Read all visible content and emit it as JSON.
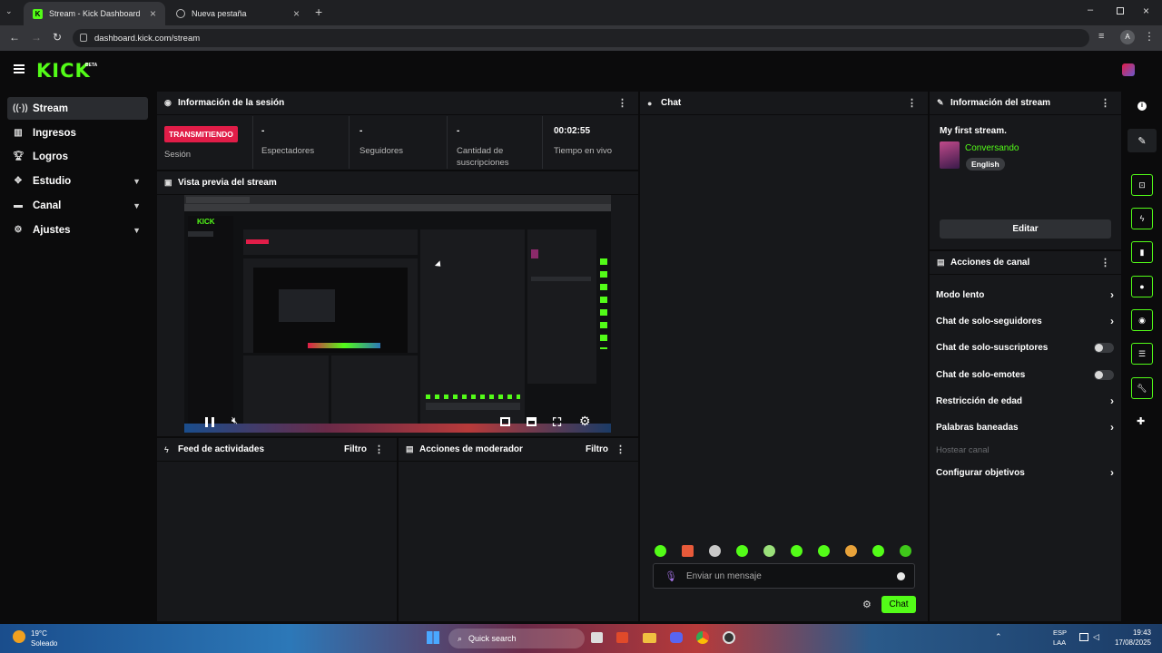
{
  "browser": {
    "tabs": [
      {
        "label": "Stream - Kick Dashboard",
        "active": true
      },
      {
        "label": "Nueva pestaña",
        "active": false
      }
    ],
    "url": "dashboard.kick.com/stream",
    "profile_initial": "A"
  },
  "app": {
    "logo": "KICK",
    "logo_badge": "BETA"
  },
  "sidebar": {
    "items": [
      {
        "label": "Stream",
        "icon": "broadcast-icon",
        "active": true,
        "chevron": false
      },
      {
        "label": "Ingresos",
        "icon": "chart-icon",
        "active": false,
        "chevron": false
      },
      {
        "label": "Logros",
        "icon": "trophy-icon",
        "active": false,
        "chevron": false
      },
      {
        "label": "Estudio",
        "icon": "studio-icon",
        "active": false,
        "chevron": true
      },
      {
        "label": "Canal",
        "icon": "channel-icon",
        "active": false,
        "chevron": true
      },
      {
        "label": "Ajustes",
        "icon": "gear-icon",
        "active": false,
        "chevron": true
      }
    ]
  },
  "session": {
    "title": "Información de la sesión",
    "status_badge": "TRANSMITIENDO",
    "status_label": "Sesión",
    "stats": [
      {
        "value": "-",
        "label": "Espectadores"
      },
      {
        "value": "-",
        "label": "Seguidores"
      },
      {
        "value": "-",
        "label": "Cantidad de suscripciones"
      },
      {
        "value": "00:02:55",
        "label": "Tiempo en vivo"
      }
    ]
  },
  "preview": {
    "title": "Vista previa del stream"
  },
  "activity": {
    "title": "Feed de actividades",
    "filter": "Filtro"
  },
  "modactions": {
    "title": "Acciones de moderador",
    "filter": "Filtro"
  },
  "chat": {
    "title": "Chat",
    "placeholder": "Enviar un mensaje",
    "send_label": "Chat",
    "emote_count": 10
  },
  "streaminfo": {
    "title": "Información del stream",
    "stream_title": "My first stream.",
    "category": "Conversando",
    "language": "English",
    "edit_label": "Editar"
  },
  "channelactions": {
    "title": "Acciones de canal",
    "items": [
      {
        "label": "Modo lento",
        "control": "arrow"
      },
      {
        "label": "Chat de solo-seguidores",
        "control": "arrow"
      },
      {
        "label": "Chat de solo-suscriptores",
        "control": "toggle"
      },
      {
        "label": "Chat de solo-emotes",
        "control": "toggle"
      },
      {
        "label": "Restricción de edad",
        "control": "arrow"
      },
      {
        "label": "Palabras baneadas",
        "control": "arrow"
      },
      {
        "label": "Hostear canal",
        "control": "disabled"
      },
      {
        "label": "Configurar objetivos",
        "control": "arrow"
      }
    ]
  },
  "taskbar": {
    "weather_temp": "19°C",
    "weather_desc": "Soleado",
    "search": "Quick search",
    "lang": "ESP",
    "lang2": "LAA",
    "time": "19:43",
    "date": "17/08/2025"
  },
  "colors": {
    "accent": "#53fc18",
    "live": "#e11d48",
    "panel": "#17181b",
    "bg": "#0b0b0c"
  }
}
